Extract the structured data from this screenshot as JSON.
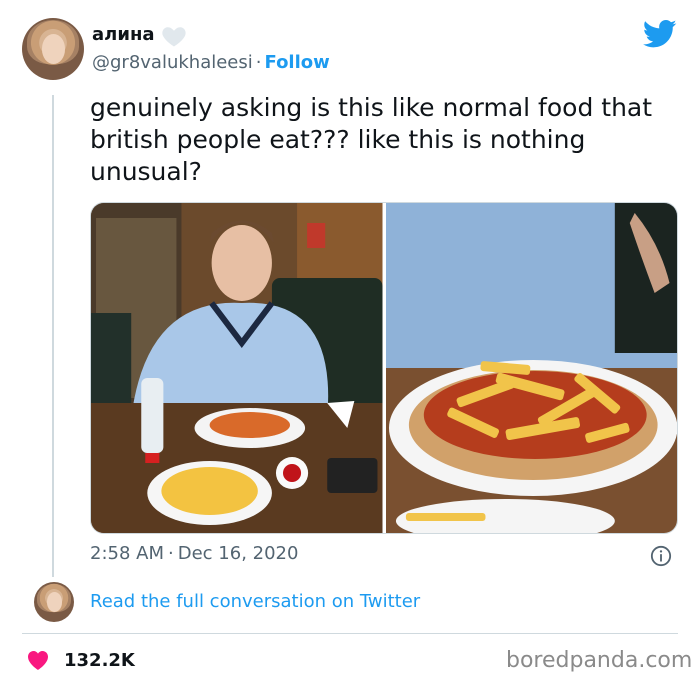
{
  "author": {
    "display_name": "алина",
    "handle": "@gr8valukhaleesi",
    "separator": "·",
    "follow_label": "Follow"
  },
  "tweet": {
    "text": "genuinely asking is this like normal food that british people eat??? like this is nothing unusual?"
  },
  "meta": {
    "time": "2:58 AM",
    "separator": "·",
    "date": "Dec 16, 2020"
  },
  "thread": {
    "read_more_label": "Read the full conversation on Twitter"
  },
  "engagement": {
    "likes": "132.2K"
  },
  "watermark": "boredpanda.com",
  "photos": [
    {
      "name": "photo-man-with-food"
    },
    {
      "name": "photo-beans-on-toast-closeup"
    }
  ],
  "icons": {
    "bird": "twitter-bird-icon",
    "verified_heart": "heart-outline-icon",
    "info": "info-icon",
    "like": "heart-icon"
  },
  "colors": {
    "accent": "#1d9bf0",
    "like": "#f91880",
    "muted": "#536471",
    "divider": "#cfd9de"
  }
}
